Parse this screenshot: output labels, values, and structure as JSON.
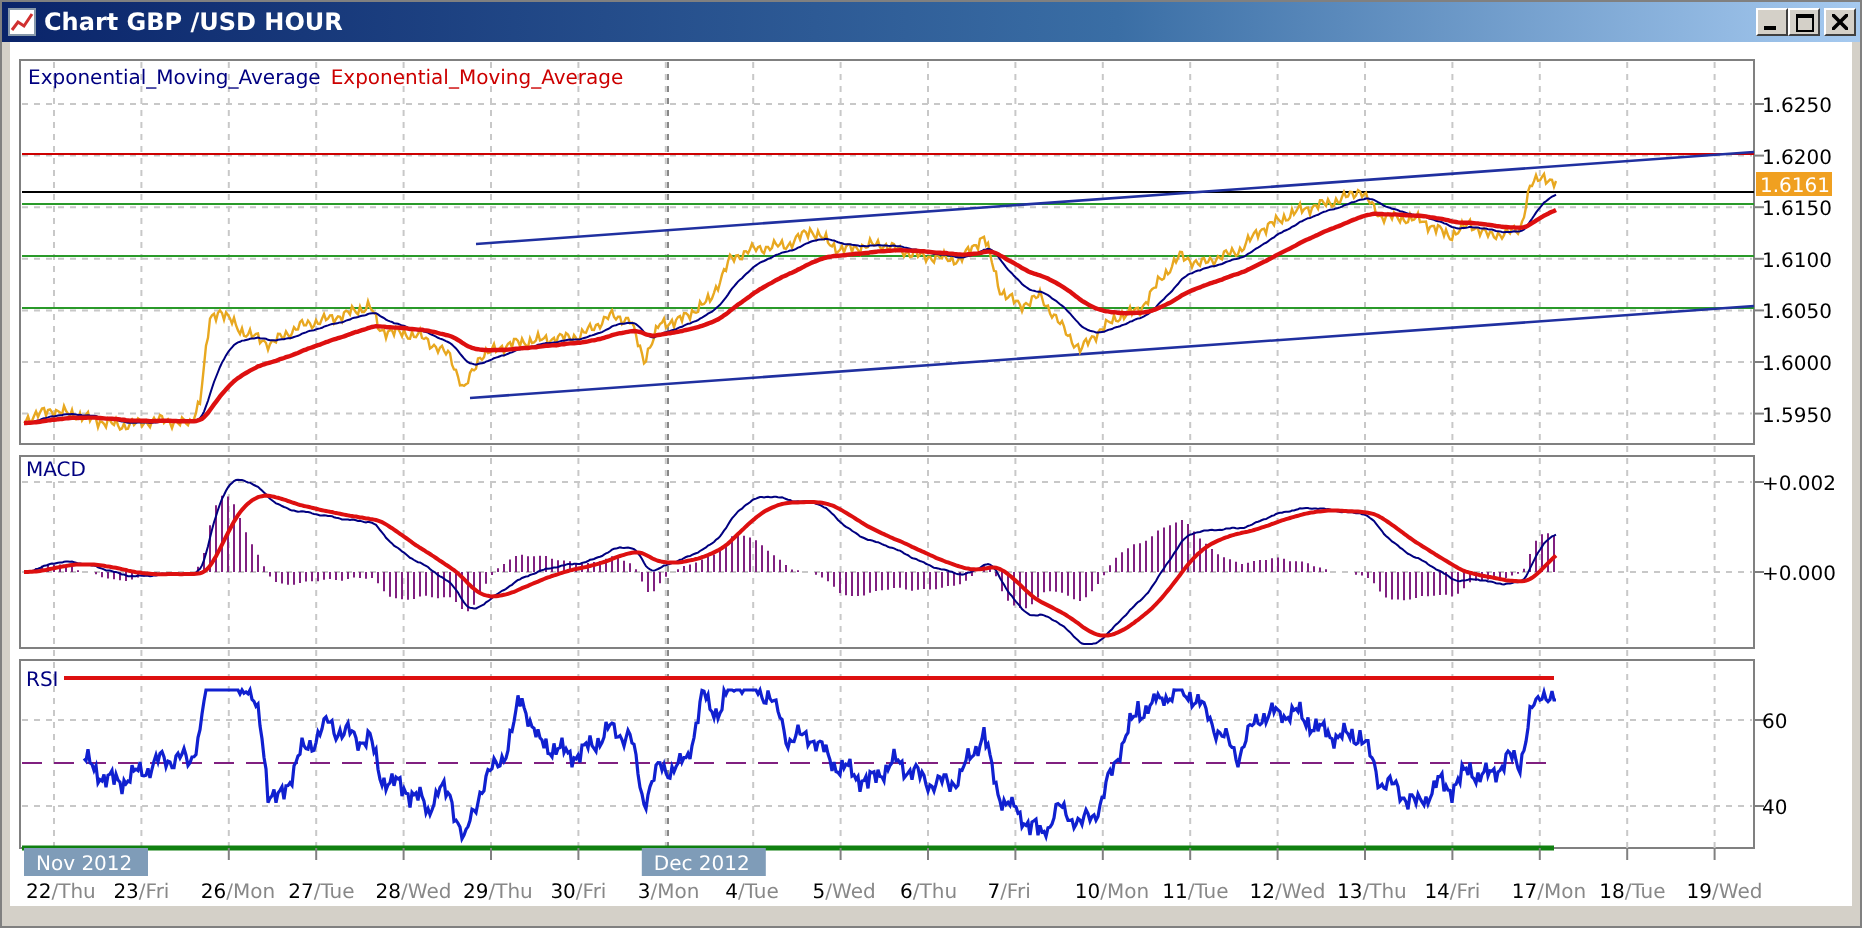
{
  "window": {
    "title": "Chart GBP /USD  HOUR"
  },
  "price_panel": {
    "legend": [
      {
        "label": "Exponential_Moving_Average",
        "color": "#000080"
      },
      {
        "label": "Exponential_Moving_Average",
        "color": "#cc0000"
      }
    ],
    "y_ticks": [
      "1.6250",
      "1.6200",
      "1.6150",
      "1.6100",
      "1.6050",
      "1.6000",
      "1.5950"
    ],
    "last_price": "1.6161"
  },
  "macd_panel": {
    "label": "MACD",
    "y_ticks": [
      "+0.002",
      "+0.000"
    ]
  },
  "rsi_panel": {
    "label": "RSI",
    "y_ticks": [
      "60",
      "40"
    ]
  },
  "time_axis": {
    "months": [
      {
        "label": "Nov 2012"
      },
      {
        "label": "Dec 2012"
      }
    ],
    "days": [
      {
        "day": "22",
        "weekday": "/Thu"
      },
      {
        "day": "23",
        "weekday": "/Fri"
      },
      {
        "day": "26",
        "weekday": "/Mon"
      },
      {
        "day": "27",
        "weekday": "/Tue"
      },
      {
        "day": "28",
        "weekday": "/Wed"
      },
      {
        "day": "29",
        "weekday": "/Thu"
      },
      {
        "day": "30",
        "weekday": "/Fri"
      },
      {
        "day": "3",
        "weekday": "/Mon"
      },
      {
        "day": "4",
        "weekday": "/Tue"
      },
      {
        "day": "5",
        "weekday": "/Wed"
      },
      {
        "day": "6",
        "weekday": "/Thu"
      },
      {
        "day": "7",
        "weekday": "/Fri"
      },
      {
        "day": "10",
        "weekday": "/Mon"
      },
      {
        "day": "11",
        "weekday": "/Tue"
      },
      {
        "day": "12",
        "weekday": "/Wed"
      },
      {
        "day": "13",
        "weekday": "/Thu"
      },
      {
        "day": "14",
        "weekday": "/Fri"
      },
      {
        "day": "17",
        "weekday": "/Mon"
      },
      {
        "day": "18",
        "weekday": "/Tue"
      },
      {
        "day": "19",
        "weekday": "/Wed"
      }
    ]
  }
}
